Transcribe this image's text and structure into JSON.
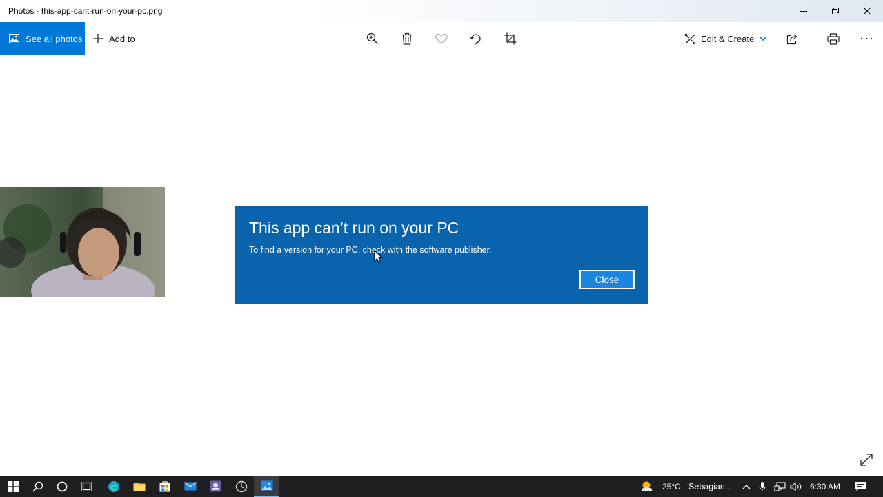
{
  "window": {
    "title": "Photos - this-app-cant-run-on-your-pc.png"
  },
  "toolbar": {
    "see_all_photos_label": "See all photos",
    "add_to_label": "Add to",
    "edit_create_label": "Edit & Create",
    "icons": [
      "zoom-icon",
      "delete-icon",
      "favorite-icon",
      "rotate-icon",
      "crop-icon",
      "share-icon",
      "print-icon",
      "more-icon"
    ]
  },
  "dialog": {
    "heading": "This app can’t run on your PC",
    "message": "To find a version for your PC, check with the software publisher.",
    "close_label": "Close"
  },
  "taskbar": {
    "weather_temp": "25°C",
    "weather_desc": "Sebagian...",
    "time": "6:30 AM"
  },
  "colors": {
    "accent": "#0078d7",
    "dialog_bg": "#0a64ad",
    "taskbar_bg": "#1f1f22"
  }
}
